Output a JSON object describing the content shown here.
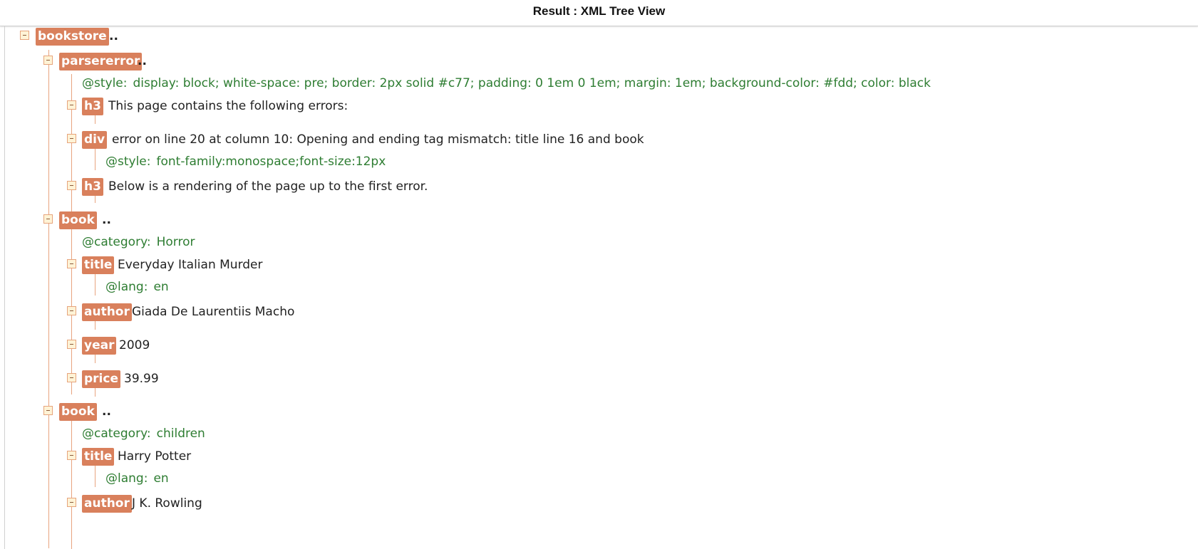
{
  "header": {
    "title": "Result : XML Tree View"
  },
  "tree": {
    "bookstore": {
      "tag": "bookstore",
      "collapsed_indicator": ".."
    },
    "parsererror": {
      "tag": "parsererror",
      "collapsed_indicator": "..",
      "style_attr": {
        "name": "@style:",
        "value": "display: block; white-space: pre; border: 2px solid #c77; padding: 0 1em 0 1em; margin: 1em; background-color: #fdd; color: black"
      },
      "h3_1": {
        "tag": "h3",
        "text": "This page contains the following errors:"
      },
      "div": {
        "tag": "div",
        "text": "error on line 20 at column 10: Opening and ending tag mismatch: title line 16 and book",
        "style_attr": {
          "name": "@style:",
          "value": "font-family:monospace;font-size:12px"
        }
      },
      "h3_2": {
        "tag": "h3",
        "text": "Below is a rendering of the page up to the first error."
      }
    },
    "book1": {
      "tag": "book",
      "collapsed_indicator": "..",
      "category": {
        "name": "@category:",
        "value": "Horror"
      },
      "title": {
        "tag": "title",
        "text": "Everyday Italian Murder",
        "lang": {
          "name": "@lang:",
          "value": "en"
        }
      },
      "author": {
        "tag": "author",
        "text": "Giada De Laurentiis Macho"
      },
      "year": {
        "tag": "year",
        "text": "2009"
      },
      "price": {
        "tag": "price",
        "text": "39.99"
      }
    },
    "book2": {
      "tag": "book",
      "collapsed_indicator": "..",
      "category": {
        "name": "@category:",
        "value": "children"
      },
      "title": {
        "tag": "title",
        "text": "Harry Potter",
        "lang": {
          "name": "@lang:",
          "value": "en"
        }
      },
      "author": {
        "tag": "author",
        "text": "J K. Rowling"
      }
    }
  },
  "colors": {
    "tag_bg": "#d9805c",
    "attr_text": "#2e7d32",
    "tree_line": "#e8a47f"
  }
}
